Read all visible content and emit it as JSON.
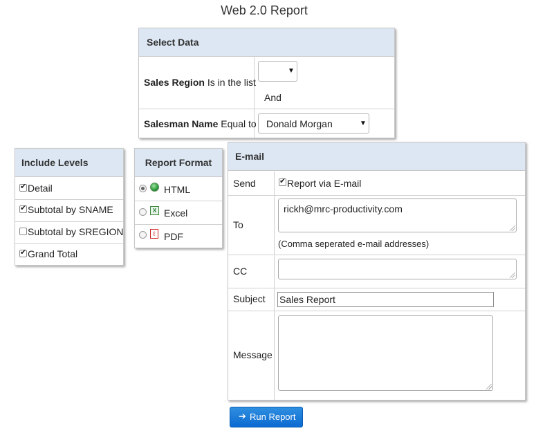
{
  "title": "Web 2.0 Report",
  "select_data": {
    "heading": "Select Data",
    "sales_region": {
      "field": "Sales Region",
      "operator": "Is in the list",
      "value": ""
    },
    "conjunction": "And",
    "salesman_name": {
      "field": "Salesman Name",
      "operator": "Equal to",
      "value": "Donald Morgan"
    }
  },
  "include_levels": {
    "heading": "Include Levels",
    "items": [
      {
        "label": "Detail",
        "checked": true
      },
      {
        "label": "Subtotal by SNAME",
        "checked": true
      },
      {
        "label": "Subtotal by SREGION",
        "checked": false
      },
      {
        "label": "Grand Total",
        "checked": true
      }
    ]
  },
  "report_format": {
    "heading": "Report Format",
    "options": [
      {
        "label": "HTML",
        "icon": "html-globe-icon",
        "selected": true
      },
      {
        "label": "Excel",
        "icon": "excel-icon",
        "selected": false
      },
      {
        "label": "PDF",
        "icon": "pdf-icon",
        "selected": false
      }
    ]
  },
  "email": {
    "heading": "E-mail",
    "send_label": "Send",
    "send_checkbox_label": "Report via E-mail",
    "send_checked": true,
    "to_label": "To",
    "to_value": "rickh@mrc-productivity.com",
    "to_hint": "(Comma seperated e-mail addresses)",
    "cc_label": "CC",
    "cc_value": "",
    "subject_label": "Subject",
    "subject_value": "Sales Report",
    "message_label": "Message",
    "message_value": ""
  },
  "run_button": {
    "label": "Run Report",
    "icon": "arrow-right-icon"
  },
  "colors": {
    "panel_header": "#dde7f3",
    "button": "#1a7ad9"
  }
}
